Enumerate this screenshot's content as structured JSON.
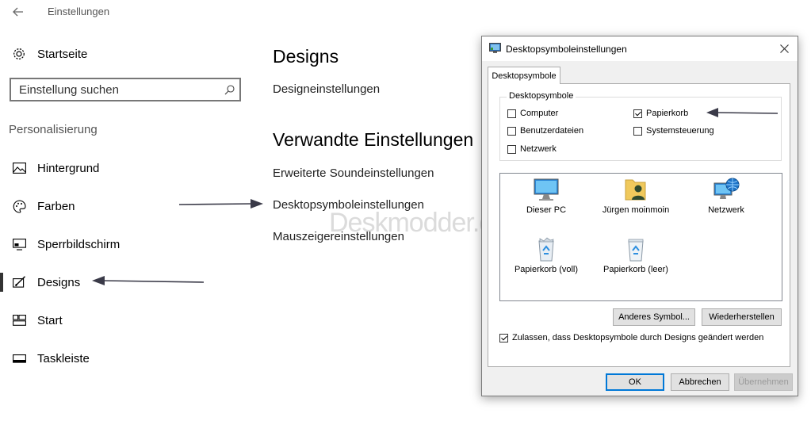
{
  "window": {
    "title": "Einstellungen"
  },
  "nav": {
    "home_label": "Startseite",
    "search_placeholder": "Einstellung suchen",
    "section_label": "Personalisierung",
    "items": [
      {
        "label": "Hintergrund",
        "icon": "picture-icon"
      },
      {
        "label": "Farben",
        "icon": "palette-icon"
      },
      {
        "label": "Sperrbildschirm",
        "icon": "monitor-icon"
      },
      {
        "label": "Designs",
        "icon": "brush-icon",
        "active": true
      },
      {
        "label": "Start",
        "icon": "start-icon"
      },
      {
        "label": "Taskleiste",
        "icon": "taskbar-icon"
      }
    ]
  },
  "main": {
    "heading": "Designs",
    "design_settings_link": "Designeinstellungen",
    "related_heading": "Verwandte Einstellungen",
    "related_links": [
      "Erweiterte Soundeinstellungen",
      "Desktopsymboleinstellungen",
      "Mauszeigereinstellungen"
    ]
  },
  "watermark": "Deskmodder.de",
  "dialog": {
    "title": "Desktopsymboleinstellungen",
    "tab": "Desktopsymbole",
    "group_label": "Desktopsymbole",
    "checkboxes": [
      {
        "label": "Computer",
        "checked": false
      },
      {
        "label": "Papierkorb",
        "checked": true
      },
      {
        "label": "Benutzerdateien",
        "checked": false
      },
      {
        "label": "Systemsteuerung",
        "checked": false
      },
      {
        "label": "Netzwerk",
        "checked": false
      }
    ],
    "icons": [
      {
        "label": "Dieser PC",
        "icon": "pc-icon"
      },
      {
        "label": "Jürgen moinmoin",
        "icon": "user-folder-icon"
      },
      {
        "label": "Netzwerk",
        "icon": "network-icon"
      },
      {
        "label": "Papierkorb (voll)",
        "icon": "recycle-bin-full-icon"
      },
      {
        "label": "Papierkorb (leer)",
        "icon": "recycle-bin-empty-icon"
      }
    ],
    "change_icon_button": "Anderes Symbol...",
    "restore_button": "Wiederherstellen",
    "allow_themes_label": "Zulassen, dass Desktopsymbole durch Designs geändert werden",
    "allow_themes_checked": true,
    "ok_button": "OK",
    "cancel_button": "Abbrechen",
    "apply_button": "Übernehmen"
  }
}
